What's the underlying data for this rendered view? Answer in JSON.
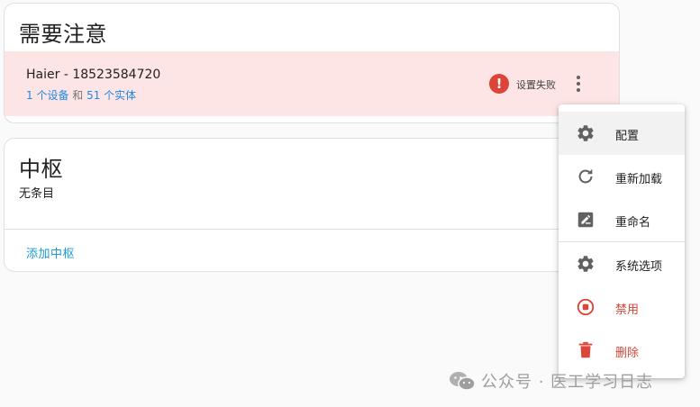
{
  "attention": {
    "title": "需要注意",
    "device": {
      "name": "Haier - 18523584720",
      "devices_link": "1 个设备",
      "and": " 和 ",
      "entities_link": "51 个实体",
      "status": "设置失败",
      "error_mark": "!"
    }
  },
  "hubs": {
    "title": "中枢",
    "empty": "无条目",
    "add_label": "添加中枢"
  },
  "menu": {
    "items": [
      {
        "label": "配置",
        "icon": "gear-icon"
      },
      {
        "label": "重新加载",
        "icon": "reload-icon"
      },
      {
        "label": "重命名",
        "icon": "rename-icon"
      },
      {
        "label": "系统选项",
        "icon": "gear-icon"
      },
      {
        "label": "禁用",
        "icon": "stop-circle-icon"
      },
      {
        "label": "删除",
        "icon": "trash-icon"
      }
    ]
  },
  "watermark": {
    "text": "公众号 · 医工学习日志"
  },
  "colors": {
    "error": "#db4437",
    "link": "#1e88e5",
    "alert_bg": "#fde5e5"
  }
}
